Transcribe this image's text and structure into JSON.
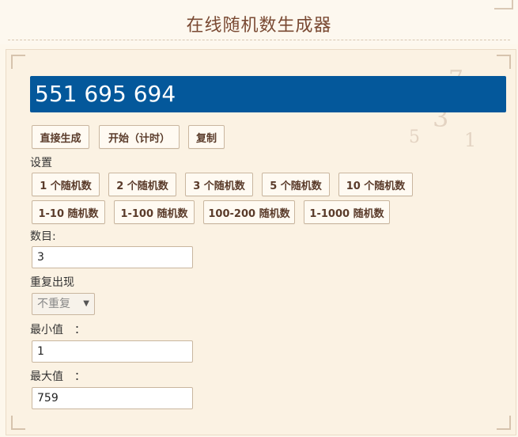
{
  "header": {
    "title": "在线随机数生成器"
  },
  "result": {
    "value": "551 695 694"
  },
  "actions": {
    "direct": "直接生成",
    "start": "开始（计时）",
    "copy": "复制"
  },
  "settings": {
    "label": "设置",
    "presets_row1": [
      "1 个随机数",
      "2 个随机数",
      "3 个随机数",
      "5 个随机数",
      "10 个随机数"
    ],
    "presets_row2": [
      "1-10 随机数",
      "1-100 随机数",
      "100-200 随机数",
      "1-1000 随机数"
    ]
  },
  "form": {
    "count_label": "数目:",
    "count_value": "3",
    "repeat_label": "重复出现",
    "repeat_value": "不重复",
    "min_label": "最小值　：",
    "min_value": "1",
    "max_label": "最大值　：",
    "max_value": "759"
  }
}
